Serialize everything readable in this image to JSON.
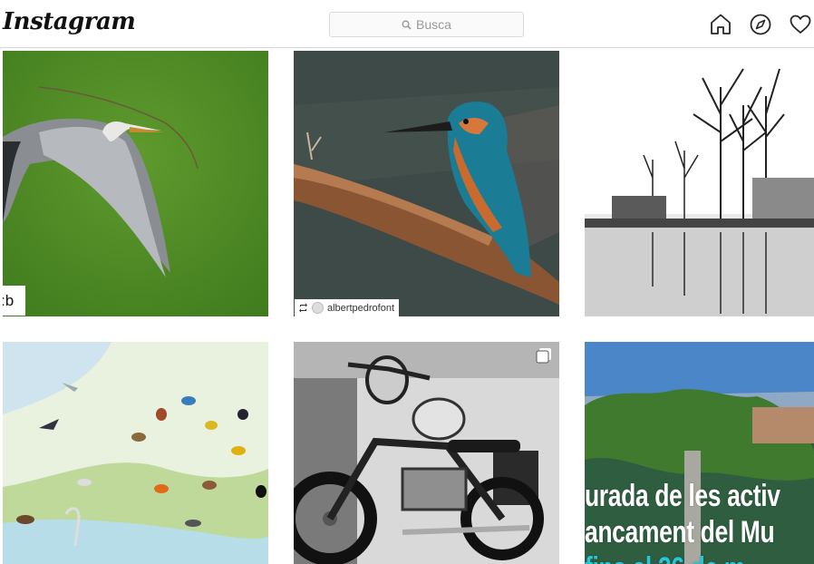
{
  "header": {
    "logo_text": "Instagram",
    "search_placeholder": "Busca",
    "nav_icons": [
      "home-icon",
      "explore-compass-icon",
      "activity-heart-icon"
    ]
  },
  "grid": {
    "posts": [
      {
        "subject": "heron",
        "overlay_label": ":b"
      },
      {
        "subject": "kingfisher",
        "repost_username": "albertpedrofont"
      },
      {
        "subject": "trees-reflection"
      },
      {
        "subject": "birds-illustration"
      },
      {
        "subject": "motorcycle",
        "multi_icon": "multiple-images-icon"
      },
      {
        "subject": "landscape-banner",
        "banner_lines": [
          "urada de les activ",
          "ancament del Mu",
          "fins al 26 de m"
        ]
      }
    ]
  },
  "colors": {
    "border": "#dbdbdb",
    "banner_accent": "#27c6d9"
  }
}
